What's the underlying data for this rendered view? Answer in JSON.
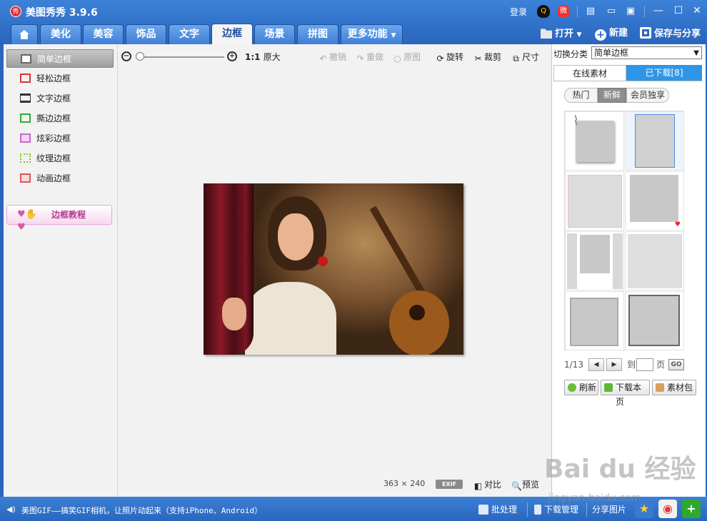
{
  "app": {
    "title": "美图秀秀 3.9.6",
    "logo_char": "秀",
    "login": "登录"
  },
  "menu": {
    "tabs": [
      {
        "label": "美化"
      },
      {
        "label": "美容"
      },
      {
        "label": "饰品"
      },
      {
        "label": "文字"
      },
      {
        "label": "边框"
      },
      {
        "label": "场景"
      },
      {
        "label": "拼图"
      },
      {
        "label": "更多功能"
      }
    ],
    "active": "边框",
    "open": "打开",
    "new": "新建",
    "save_share": "保存与分享"
  },
  "sidebar": {
    "items": [
      {
        "label": "简单边框"
      },
      {
        "label": "轻松边框"
      },
      {
        "label": "文字边框"
      },
      {
        "label": "撕边边框"
      },
      {
        "label": "炫彩边框"
      },
      {
        "label": "纹理边框"
      },
      {
        "label": "动画边框"
      }
    ],
    "tutorial": "边框教程"
  },
  "toolbar": {
    "ratio": "1:1",
    "original_size": "原大",
    "undo": "撤销",
    "redo": "重做",
    "original": "原图",
    "rotate": "旋转",
    "crop": "裁剪",
    "resize": "尺寸"
  },
  "canvas": {
    "width": "363",
    "times": "×",
    "height": "240",
    "exif": "EXIF",
    "compare": "对比",
    "preview": "预览"
  },
  "right_panel": {
    "category_label": "切换分类",
    "category_value": "简单边框",
    "tab_online": "在线素材",
    "tab_downloaded": "已下载[8]",
    "filters": [
      "热门",
      "新鲜",
      "会员独享"
    ],
    "pager": {
      "current": "1/13",
      "to": "到",
      "page": "页",
      "go": "GO"
    },
    "actions": {
      "refresh": "刷新",
      "download_page": "下载本页",
      "material_pack": "素材包"
    }
  },
  "bottom": {
    "marquee": "美图GIF——搞笑GIF相机，让照片动起来（支持iPhone、Android）",
    "batch": "批处理",
    "download_manager": "下载管理",
    "share_image": "分享图片"
  },
  "watermark": {
    "main": "Bai du 经验",
    "sub": "jingyan.baidu.com"
  },
  "colors": {
    "chrome_blue": "#2a66be",
    "active_tab_text": "#1d4e9c",
    "downloaded_tab": "#2e96e6"
  }
}
